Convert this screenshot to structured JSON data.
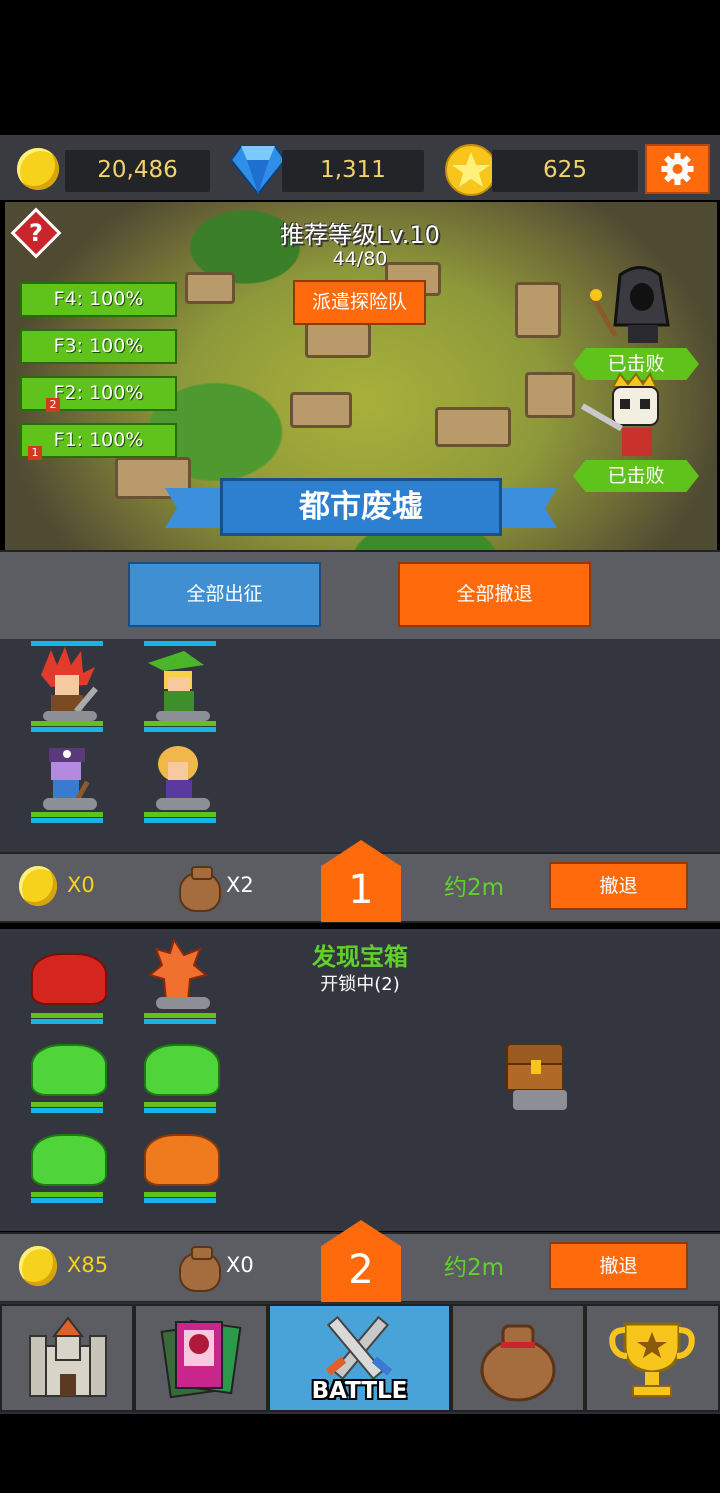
{
  "resources": {
    "gold": "20,486",
    "gems": "1,311",
    "stars": "625"
  },
  "dungeon": {
    "recommended_level": "推荐等级Lv.10",
    "progress": "44/80",
    "dispatch_label": "派遣探险队",
    "floors": [
      {
        "label": "F4: 100%",
        "tag": ""
      },
      {
        "label": "F3: 100%",
        "tag": ""
      },
      {
        "label": "F2: 100%",
        "tag": "2"
      },
      {
        "label": "F1: 100%",
        "tag": "1"
      }
    ],
    "bosses": [
      {
        "status": "已击败"
      },
      {
        "status": "已击败"
      }
    ],
    "name": "都市废墟"
  },
  "actions": {
    "deploy_all": "全部出征",
    "retreat_all": "全部撤退"
  },
  "parties": [
    {
      "number": "1",
      "gold": "X0",
      "bags": "X2",
      "eta": "约2m",
      "retreat": "撤退"
    },
    {
      "number": "2",
      "gold": "X85",
      "bags": "X0",
      "eta": "约2m",
      "retreat": "撤退",
      "event_title": "发现宝箱",
      "event_status": "开锁中(2)"
    }
  ],
  "nav": {
    "battle_label": "BATTLE",
    "tabs": [
      "castle-icon",
      "cards-icon",
      "battle-icon",
      "bag-icon",
      "trophy-icon"
    ]
  },
  "colors": {
    "accent": "#ff6a0d",
    "blue": "#3f8fd2",
    "green": "#5fc31b",
    "gold_text": "#f2d36b"
  }
}
